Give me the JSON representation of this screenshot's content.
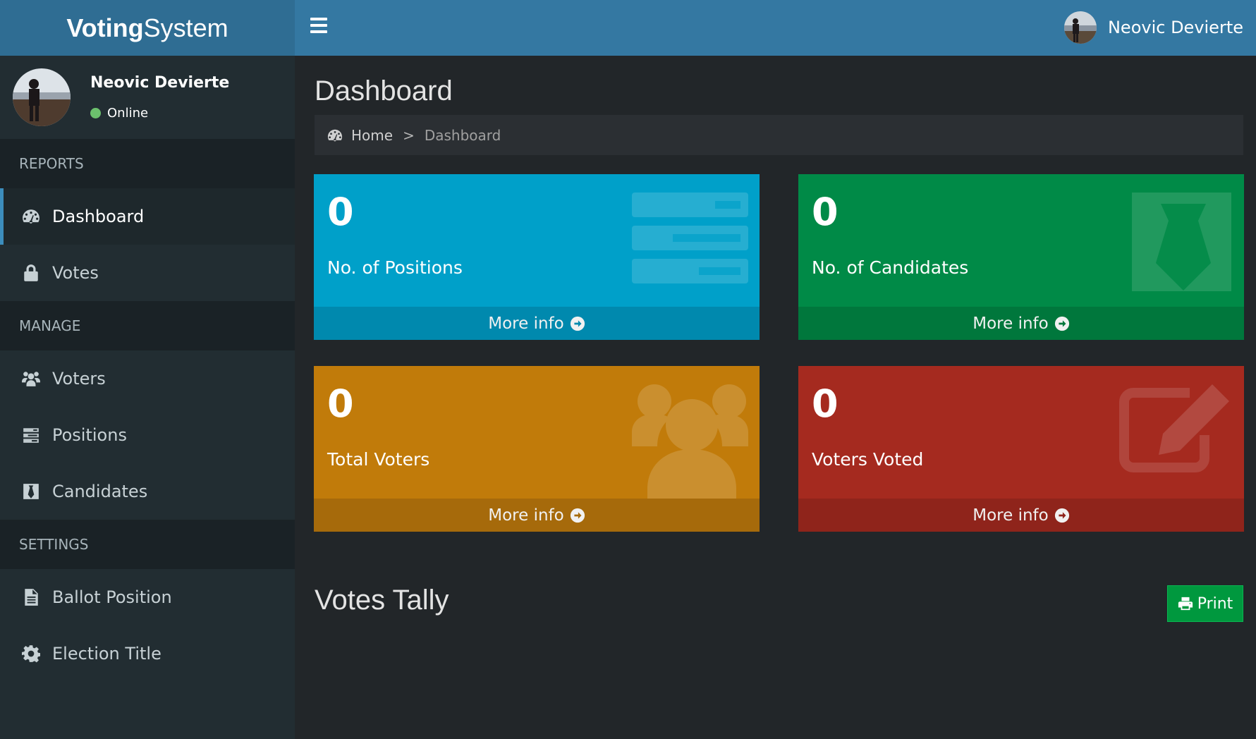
{
  "header": {
    "logo_bold": "Voting",
    "logo_light": "System",
    "user_name": "Neovic Devierte"
  },
  "sidebar": {
    "user": {
      "name": "Neovic Devierte",
      "status": "Online"
    },
    "sections": [
      {
        "title": "REPORTS",
        "items": [
          {
            "label": "Dashboard",
            "icon": "dashboard-icon"
          },
          {
            "label": "Votes",
            "icon": "lock-icon"
          }
        ]
      },
      {
        "title": "MANAGE",
        "items": [
          {
            "label": "Voters",
            "icon": "users-icon"
          },
          {
            "label": "Positions",
            "icon": "tasks-icon"
          },
          {
            "label": "Candidates",
            "icon": "tie-icon"
          }
        ]
      },
      {
        "title": "SETTINGS",
        "items": [
          {
            "label": "Ballot Position",
            "icon": "file-text-icon"
          },
          {
            "label": "Election Title",
            "icon": "cog-icon"
          }
        ]
      }
    ]
  },
  "main": {
    "title": "Dashboard",
    "breadcrumb": {
      "home": "Home",
      "separator": ">",
      "current": "Dashboard"
    },
    "boxes": [
      {
        "value": "0",
        "label": "No. of Positions",
        "more": "More info",
        "color": "#00a0c9"
      },
      {
        "value": "0",
        "label": "No. of Candidates",
        "more": "More info",
        "color": "#008a47"
      },
      {
        "value": "0",
        "label": "Total Voters",
        "more": "More info",
        "color": "#c17b0a"
      },
      {
        "value": "0",
        "label": "Voters Voted",
        "more": "More info",
        "color": "#a52a1f"
      }
    ],
    "tally_title": "Votes Tally",
    "print_label": "Print"
  }
}
